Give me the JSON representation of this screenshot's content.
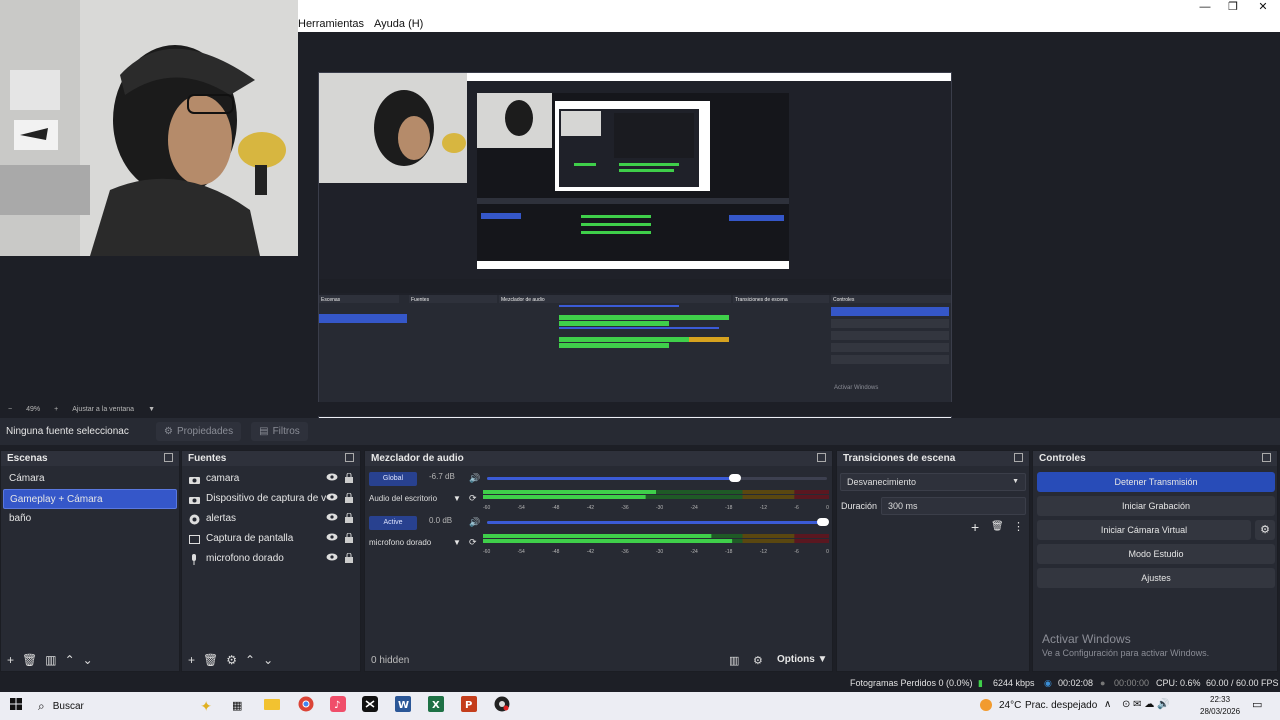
{
  "menu": {
    "items": [
      "Herramientas",
      "Ayuda (H)"
    ]
  },
  "window_controls": {
    "minimize": "—",
    "maximize": "❐",
    "close": "✕"
  },
  "zoom": {
    "level": "49%",
    "fit_label": "Ajustar a la ventana"
  },
  "source_bar": {
    "selection": "Ninguna fuente seleccionac",
    "properties": "Propiedades",
    "filters": "Filtros"
  },
  "scenes": {
    "title": "Escenas",
    "items": [
      "Cámara",
      "Gameplay + Cámara",
      "baño"
    ],
    "active_index": 1
  },
  "sources": {
    "title": "Fuentes",
    "items": [
      {
        "label": "camara",
        "icon": "camera-icon"
      },
      {
        "label": "Dispositivo de captura de video",
        "icon": "camera-icon"
      },
      {
        "label": "alertas",
        "icon": "browser-globe-icon"
      },
      {
        "label": "Captura de pantalla",
        "icon": "monitor-icon"
      },
      {
        "label": "microfono dorado",
        "icon": "microphone-icon"
      }
    ]
  },
  "mixer": {
    "title": "Mezclador de audio",
    "hidden_label": "0 hidden",
    "options_label": "Options",
    "scale": [
      "-60",
      "-54",
      "-48",
      "-42",
      "-36",
      "-30",
      "-24",
      "-18",
      "-12",
      "-6",
      "0"
    ],
    "channels": [
      {
        "badge": "Global",
        "db": "-6.7 dB",
        "name": "Audio del escritorio",
        "volume": 0.74,
        "level_a": 0.5,
        "level_b": 0.47
      },
      {
        "badge": "Active",
        "db": "0.0 dB",
        "name": "microfono dorado",
        "volume": 1.0,
        "level_a": 0.66,
        "level_b": 0.72
      }
    ]
  },
  "transitions": {
    "title": "Transiciones de escena",
    "selected": "Desvanecimiento",
    "duration_label": "Duración",
    "duration_value": "300 ms"
  },
  "controls": {
    "title": "Controles",
    "buttons": [
      "Detener Transmisión",
      "Iniciar Grabación",
      "Iniciar Cámara Virtual",
      "Modo Estudio",
      "Ajustes"
    ]
  },
  "activation": {
    "title": "Activar Windows",
    "subtitle": "Ve a Configuración para activar Windows."
  },
  "status": {
    "frames": "Fotogramas Perdidos 0 (0.0%)",
    "bitrate": "6244 kbps",
    "stream_time": "00:02:08",
    "rec_time": "00:00:00",
    "cpu": "CPU: 0.6%",
    "fps": "60.00 / 60.00 FPS"
  },
  "taskbar": {
    "search": "Buscar",
    "weather_temp": "24°C",
    "weather_desc": "Prac. despejado",
    "time": "22:33",
    "date": "28/03/2026"
  },
  "nested_preview": {
    "scenes_title": "Escenas",
    "sources_title": "Fuentes",
    "mixer_title": "Mezclador de audio",
    "transitions_title": "Transiciones de escena",
    "controls_title": "Controles",
    "activation_title": "Activar Windows"
  },
  "colors": {
    "accent": "#3557c9",
    "panel": "#272a33",
    "background": "#1d1f26",
    "meter_green": "#3fcf4a",
    "meter_yellow": "#d6a21f",
    "meter_red": "#c0283a"
  }
}
